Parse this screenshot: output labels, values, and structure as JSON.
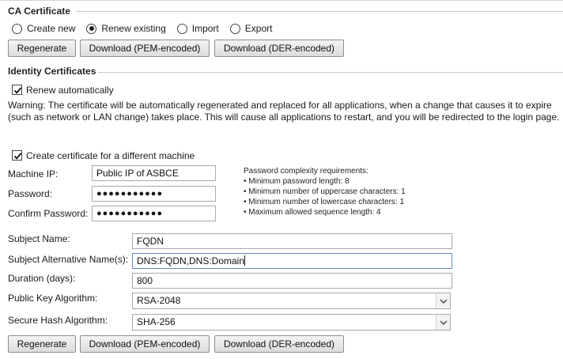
{
  "ca": {
    "title": "CA Certificate",
    "options": [
      "Create new",
      "Renew existing",
      "Import",
      "Export"
    ],
    "selected": "Renew existing",
    "regenerate": "Regenerate",
    "download_pem": "Download (PEM-encoded)",
    "download_der": "Download (DER-encoded)"
  },
  "identity": {
    "title": "Identity Certificates",
    "renew_label": "Renew automatically",
    "renew_checked": true,
    "warning": "Warning: The certificate will be automatically regenerated and replaced for all applications, when a change that causes it to expire (such as network or LAN change) takes place. This will cause all applications to restart, and you will be redirected to the login page.",
    "different_machine_label": "Create certificate for a different machine",
    "different_machine_checked": true,
    "machine_ip_label": "Machine IP:",
    "machine_ip_value": "Public IP of ASBCE",
    "password_label": "Password:",
    "password_value": "●●●●●●●●●●●",
    "confirm_label": "Confirm Password:",
    "confirm_value": "●●●●●●●●●●●",
    "requirements": {
      "heading": "Password complexity requirements:",
      "items": [
        "• Minimum password length: 8",
        "• Minimum number of uppercase characters: 1",
        "• Minimum number of lowercase characters: 1",
        "• Maximum allowed sequence length: 4"
      ]
    },
    "subject_name_label": "Subject Name:",
    "subject_name_value": "FQDN",
    "san_label": "Subject Alternative Name(s):",
    "san_value": "DNS:FQDN,DNS:Domain",
    "duration_label": "Duration (days):",
    "duration_value": "800",
    "pk_alg_label": "Public Key Algorithm:",
    "pk_alg_value": "RSA-2048",
    "hash_alg_label": "Secure Hash Algorithm:",
    "hash_alg_value": "SHA-256",
    "regenerate": "Regenerate",
    "download_pem": "Download (PEM-encoded)",
    "download_der": "Download (DER-encoded)"
  }
}
